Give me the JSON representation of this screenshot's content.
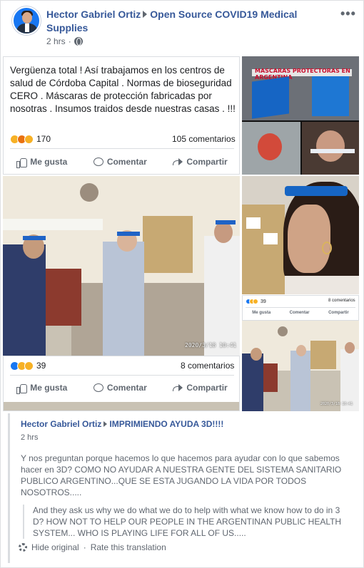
{
  "post": {
    "author": "Hector Gabriel Ortiz",
    "group": "Open Source COVID19 Medical Supplies",
    "time": "2 hrs",
    "more_label": "•••"
  },
  "shared_post": {
    "text": "Vergüenza total ! Así trabajamos en los centros de salud de Córdoba Capital . Normas de bioseguridad CERO . Máscaras de protección fabricadas por nosotras . Insumos traidos desde nuestras casas . !!!",
    "reaction_count": "170",
    "comment_count": "105 comentarios",
    "actions": {
      "like": "Me gusta",
      "comment": "Comentar",
      "share": "Compartir"
    }
  },
  "photo_post": {
    "timestamp": "2020/3/18 10:41",
    "reaction_count": "39",
    "comment_count": "8 comentarios",
    "actions": {
      "like": "Me gusta",
      "comment": "Comentar",
      "share": "Compartir"
    }
  },
  "right_top": {
    "banner": "MASCARAS PROTECTORAS EN ARGENTINA"
  },
  "right_small": {
    "reaction_count": "39",
    "comment_count": "8 comentarios",
    "actions": {
      "like": "Me gusta",
      "comment": "Comentar",
      "share": "Compartir"
    }
  },
  "right_bot": {
    "timestamp": "2020/3/18 10:41"
  },
  "post2": {
    "author": "Hector Gabriel Ortiz",
    "target": "IMPRIMIENDO AYUDA 3D!!!!",
    "time": "2 hrs",
    "body": "Y nos preguntan porque hacemos lo que hacemos para ayudar con lo que sabemos hacer en 3D? COMO NO AYUDAR A NUESTRA GENTE DEL SISTEMA SANITARIO PUBLICO ARGENTINO...QUE SE ESTA JUGANDO LA VIDA POR TODOS NOSOTROS.....",
    "translation": "And they ask us why we do what we do to help with what we know how to do in 3 D? HOW NOT TO HELP OUR PEOPLE IN THE ARGENTINAN PUBLIC HEALTH SYSTEM... WHO IS PLAYING LIFE FOR ALL OF US.....",
    "hide_original": "Hide original",
    "separator": "·",
    "rate_translation": "Rate this translation"
  },
  "colors": {
    "link": "#365899",
    "brand": "#1877f2",
    "mask": "#1665c4"
  }
}
